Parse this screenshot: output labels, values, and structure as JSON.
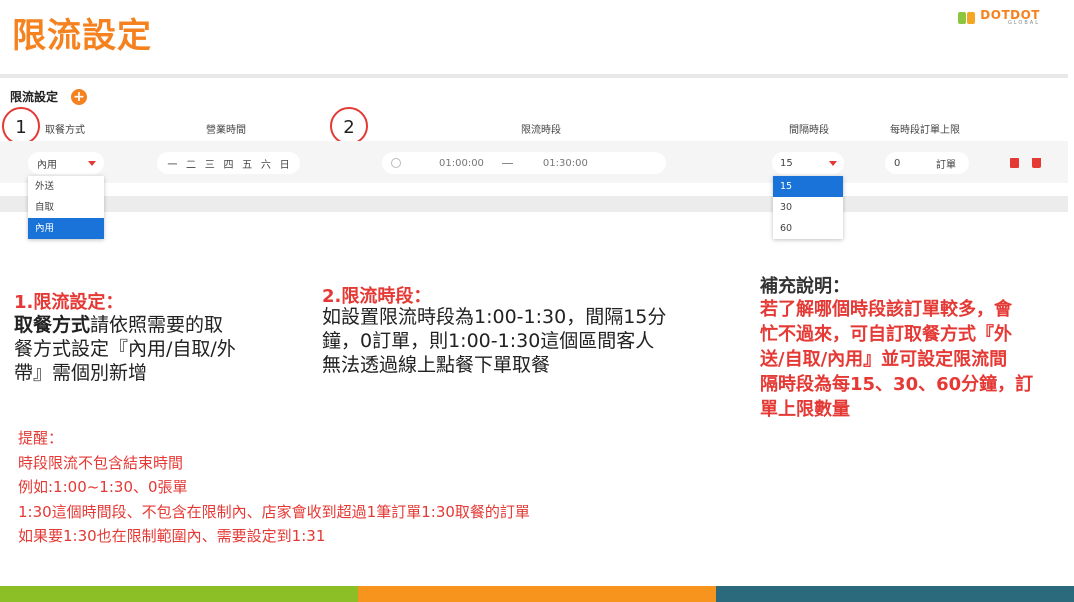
{
  "header": {
    "title": "限流設定",
    "logo_brand": "DOTDOT",
    "logo_sub": "GLOBAL"
  },
  "panel": {
    "section_label": "限流設定",
    "add_icon": "plus-icon",
    "columns": {
      "meal_method": "取餐方式",
      "business_hours": "營業時間",
      "limit_period": "限流時段",
      "interval": "間隔時段",
      "order_limit": "每時段訂單上限"
    },
    "row": {
      "meal_method_value": "內用",
      "weekdays": [
        "一",
        "二",
        "三",
        "四",
        "五",
        "六",
        "日"
      ],
      "clock_icon": "clock-icon",
      "start_time": "01:00:00",
      "end_time": "01:30:00",
      "interval_value": "15",
      "order_limit_value": "0",
      "order_unit": "訂單"
    },
    "meal_options": [
      "外送",
      "自取",
      "內用"
    ],
    "meal_selected": "內用",
    "interval_options": [
      "15",
      "30",
      "60"
    ],
    "interval_selected": "15",
    "markers": [
      "1",
      "2"
    ]
  },
  "notes": {
    "n1_title": "1.限流設定：",
    "n1_bold": "取餐方式",
    "n1_line1_rest": "請依照需要的取",
    "n1_line2": "餐方式設定『內用/自取/外",
    "n1_line3": "帶』需個別新增",
    "n2_title": "2.限流時段：",
    "n2_line1": "如設置限流時段為1:00-1:30，間隔15分",
    "n2_line2": "鐘，0訂單，則1:00-1:30這個區間客人",
    "n2_line3": "無法透過線上點餐下單取餐",
    "reminder": [
      "提醒：",
      "時段限流不包含結束時間",
      "例如:1:00~1:30、0張單",
      "1:30這個時間段、不包含在限制內、店家會收到超過1筆訂單1:30取餐的訂單",
      "如果要1:30也在限制範圍內、需要設定到1:31"
    ],
    "supp_title": "補充說明：",
    "supp_lines": [
      "若了解哪個時段該訂單較多，會",
      "忙不過來，可自訂取餐方式『外",
      "送/自取/內用』並可設定限流間",
      "隔時段為每15、30、60分鐘，訂",
      "單上限數量"
    ]
  },
  "colors": {
    "accent": "#f5821f",
    "red": "#e53935",
    "select_blue": "#1a73d9",
    "bar_green": "#8cbf26",
    "bar_orange": "#f7941d",
    "bar_teal": "#2b6a7c"
  }
}
